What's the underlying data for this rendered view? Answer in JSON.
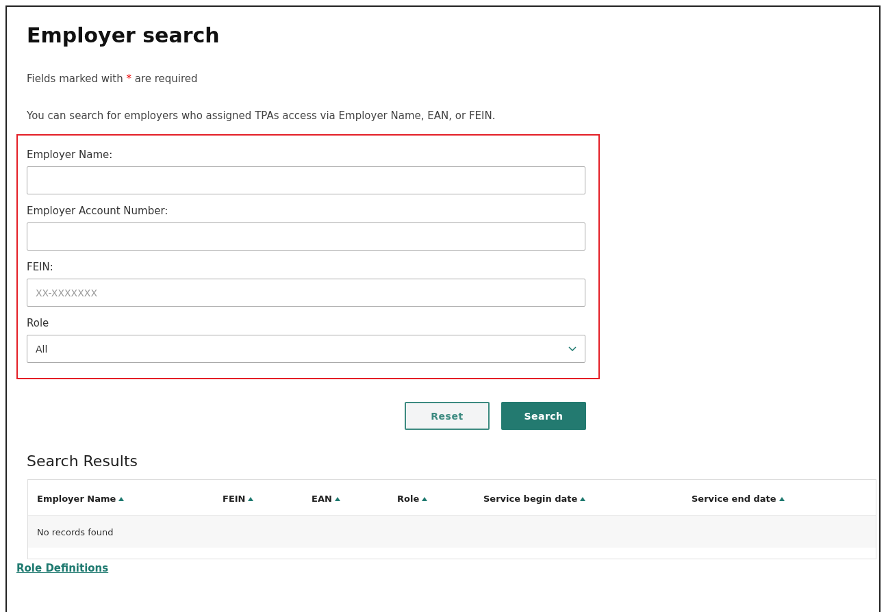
{
  "title": "Employer search",
  "required_note": {
    "before": "Fields marked with",
    "mark": "*",
    "after": "are required"
  },
  "intro": "You can search for employers who assigned TPAs access via Employer Name, EAN, or FEIN.",
  "form": {
    "highlighted": true,
    "fields": [
      {
        "kind": "text",
        "label": "Employer Name:"
      },
      {
        "kind": "text",
        "label": "Employer Account Number:"
      },
      {
        "kind": "text",
        "label": "FEIN:",
        "placeholder": "XX-XXXXXXX"
      },
      {
        "kind": "select",
        "label": "Role",
        "value": "All"
      }
    ]
  },
  "buttons": [
    {
      "kind": "secondary",
      "label": "Reset"
    },
    {
      "kind": "primary",
      "label": "Search"
    }
  ],
  "results": {
    "title": "Search Results",
    "columns": [
      "Employer Name",
      "FEIN",
      "EAN",
      "Role",
      "Service begin date",
      "Service end date"
    ],
    "empty_message": "No records found"
  },
  "link": "Role Definitions"
}
